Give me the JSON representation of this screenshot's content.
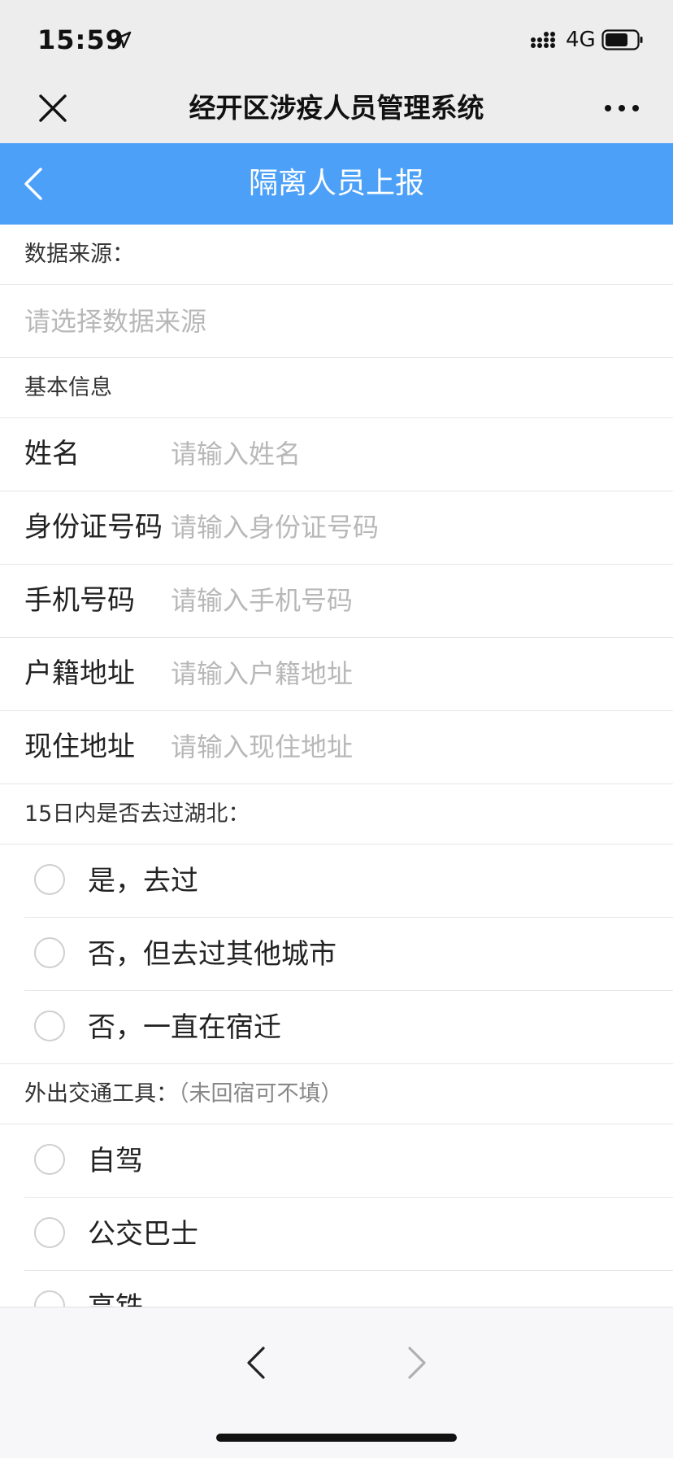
{
  "status_bar": {
    "time": "15:59",
    "network": "4G"
  },
  "wechat_header": {
    "title": "经开区涉疫人员管理系统"
  },
  "app_bar": {
    "title": "隔离人员上报"
  },
  "data_source": {
    "label": "数据来源：",
    "placeholder": "请选择数据来源"
  },
  "basic_info": {
    "header": "基本信息",
    "fields": [
      {
        "label": "姓名",
        "placeholder": "请输入姓名",
        "value": ""
      },
      {
        "label": "身份证号码",
        "placeholder": "请输入身份证号码",
        "value": ""
      },
      {
        "label": "手机号码",
        "placeholder": "请输入手机号码",
        "value": ""
      },
      {
        "label": "户籍地址",
        "placeholder": "请输入户籍地址",
        "value": ""
      },
      {
        "label": "现住地址",
        "placeholder": "请输入现住地址",
        "value": ""
      }
    ]
  },
  "hubei_question": {
    "header": "15日内是否去过湖北：",
    "options": [
      {
        "label": "是，去过"
      },
      {
        "label": "否，但去过其他城市"
      },
      {
        "label": "否，一直在宿迁"
      }
    ]
  },
  "transport_question": {
    "header": "外出交通工具：",
    "note": "（未回宿可不填）",
    "options": [
      {
        "label": "自驾"
      },
      {
        "label": "公交巴士"
      },
      {
        "label": "高铁"
      }
    ]
  },
  "colors": {
    "app_bar": "#4ca0f8",
    "chrome_bg": "#ededed",
    "placeholder": "#b8b8b8",
    "divider": "#e6e6e6"
  },
  "icons": [
    "location-arrow-icon",
    "signal-icon",
    "battery-icon",
    "close-icon",
    "more-icon",
    "back-chevron-icon",
    "nav-back-icon",
    "nav-forward-icon"
  ]
}
